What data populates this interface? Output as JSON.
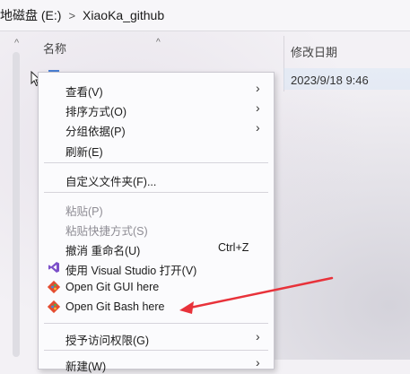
{
  "address_bar": {
    "drive": "本地磁盘 (E:)",
    "separator": ">",
    "folder": "XiaoKa_github"
  },
  "columns": {
    "name": "名称",
    "date_modified": "修改日期"
  },
  "file_row": {
    "date_modified": "2023/9/18 9:46"
  },
  "context_menu": {
    "items": [
      {
        "label": "查看(V)",
        "submenu": true
      },
      {
        "label": "排序方式(O)",
        "submenu": true
      },
      {
        "label": "分组依据(P)",
        "submenu": true
      },
      {
        "label": "刷新(E)"
      },
      {
        "label": "自定义文件夹(F)..."
      },
      {
        "label": "粘贴(P)",
        "disabled": true
      },
      {
        "label": "粘贴快捷方式(S)",
        "disabled": true
      },
      {
        "label": "撤消 重命名(U)",
        "shortcut": "Ctrl+Z"
      },
      {
        "label": "使用 Visual Studio 打开(V)",
        "icon": "visual-studio-icon"
      },
      {
        "label": "Open Git GUI here",
        "icon": "git-icon"
      },
      {
        "label": "Open Git Bash here",
        "icon": "git-icon"
      },
      {
        "label": "授予访问权限(G)",
        "submenu": true
      },
      {
        "label": "新建(W)",
        "submenu": true
      }
    ]
  },
  "colors": {
    "annotation_arrow": "#e8323a",
    "visual_studio": "#7b4fc9"
  }
}
